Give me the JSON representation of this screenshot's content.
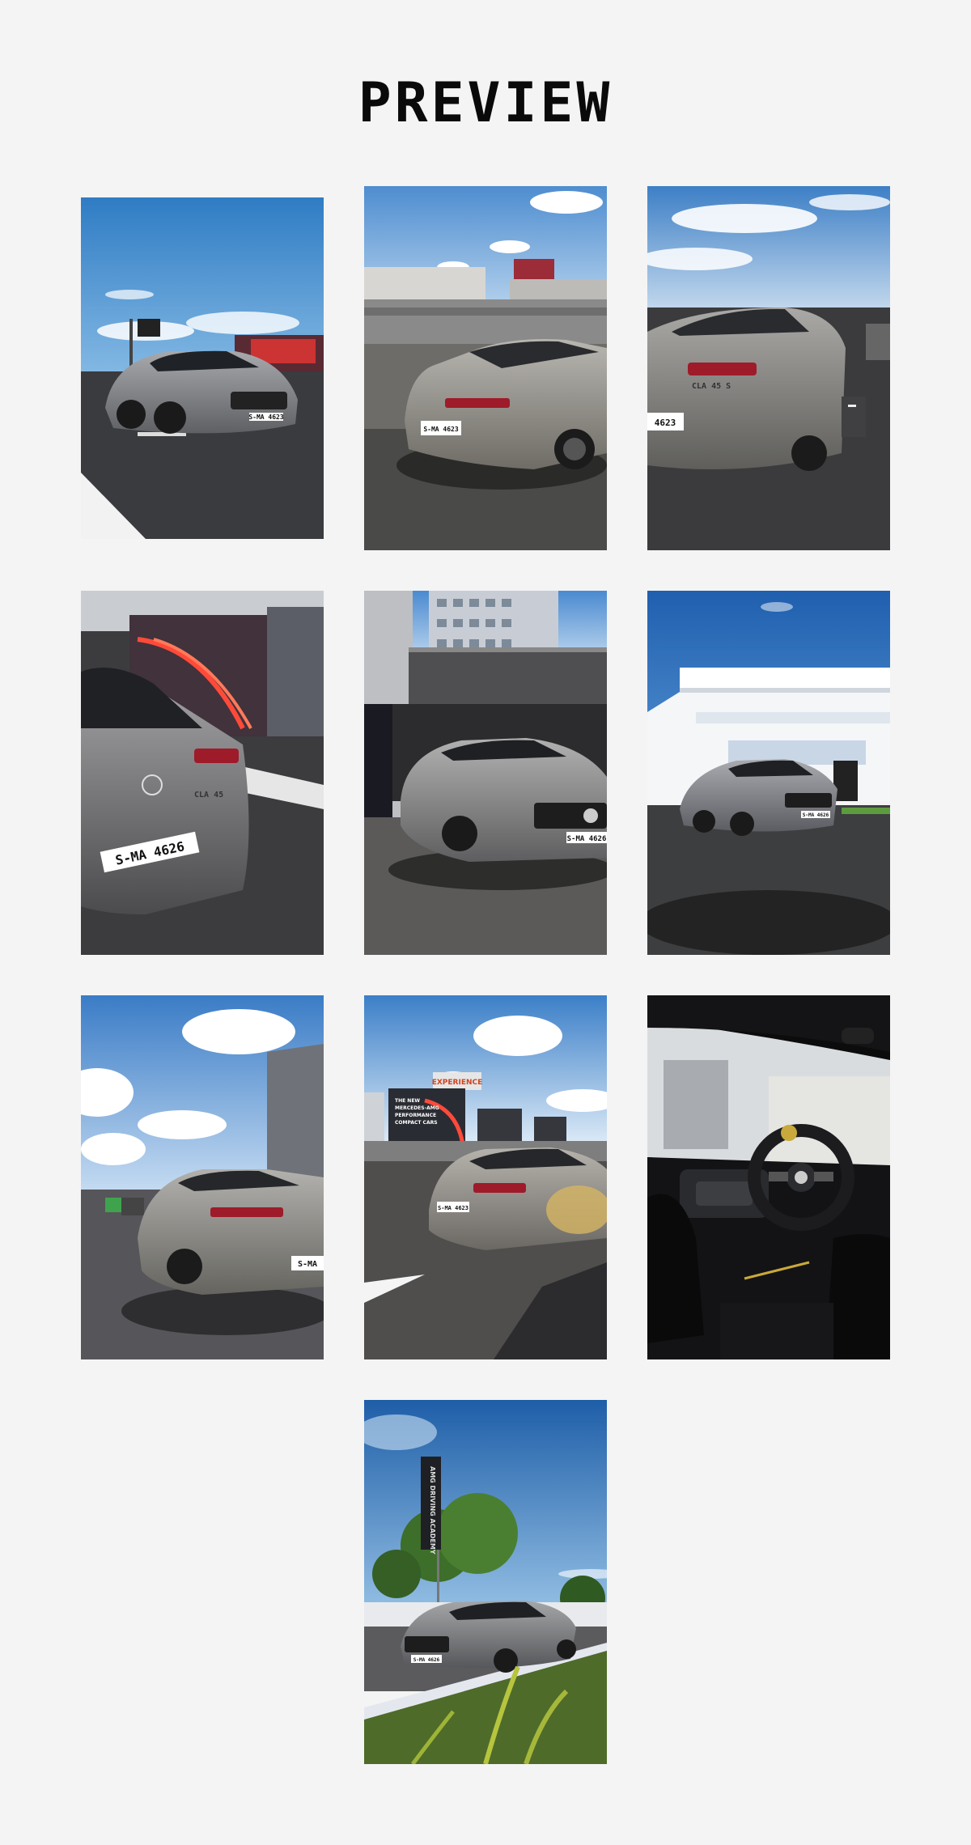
{
  "page": {
    "title": "PREVIEW"
  },
  "photos": [
    {
      "subject": "front three-quarter at track",
      "plate": "S-MA 4623"
    },
    {
      "subject": "rear three-quarter by grandstand",
      "plate": "S-MA 4623"
    },
    {
      "subject": "rear close-up with badge",
      "plate": "4623",
      "badge": "CLA 45 S"
    },
    {
      "subject": "rear close-up by track banner",
      "plate": "S-MA 4626",
      "badge": "CLA 45"
    },
    {
      "subject": "front by pit building",
      "plate": "S-MA 4626"
    },
    {
      "subject": "front by white clubhouse",
      "plate": "S-MA 4626"
    },
    {
      "subject": "row of cars in pit lane",
      "plate": "S-MA"
    },
    {
      "subject": "rear by track banners",
      "plate": "S-MA 4623",
      "banner_brand": "EXPERIENCE",
      "banner_text_1": "THE NEW",
      "banner_text_2": "MERCEDES-AMG",
      "banner_text_3": "PERFORMANCE",
      "banner_text_4": "COMPACT CARS"
    },
    {
      "subject": "interior steering wheel"
    },
    {
      "subject": "front by flag and trees",
      "plate": "S-MA 4626",
      "flag_text": "AMG DRIVING ACADEMY"
    }
  ],
  "colors": {
    "background": "#f4f4f5",
    "title": "#0a0a0a",
    "car_silver": "#8e8f91",
    "sky_blue": "#3f86c8",
    "asphalt": "#3a3b3e"
  }
}
